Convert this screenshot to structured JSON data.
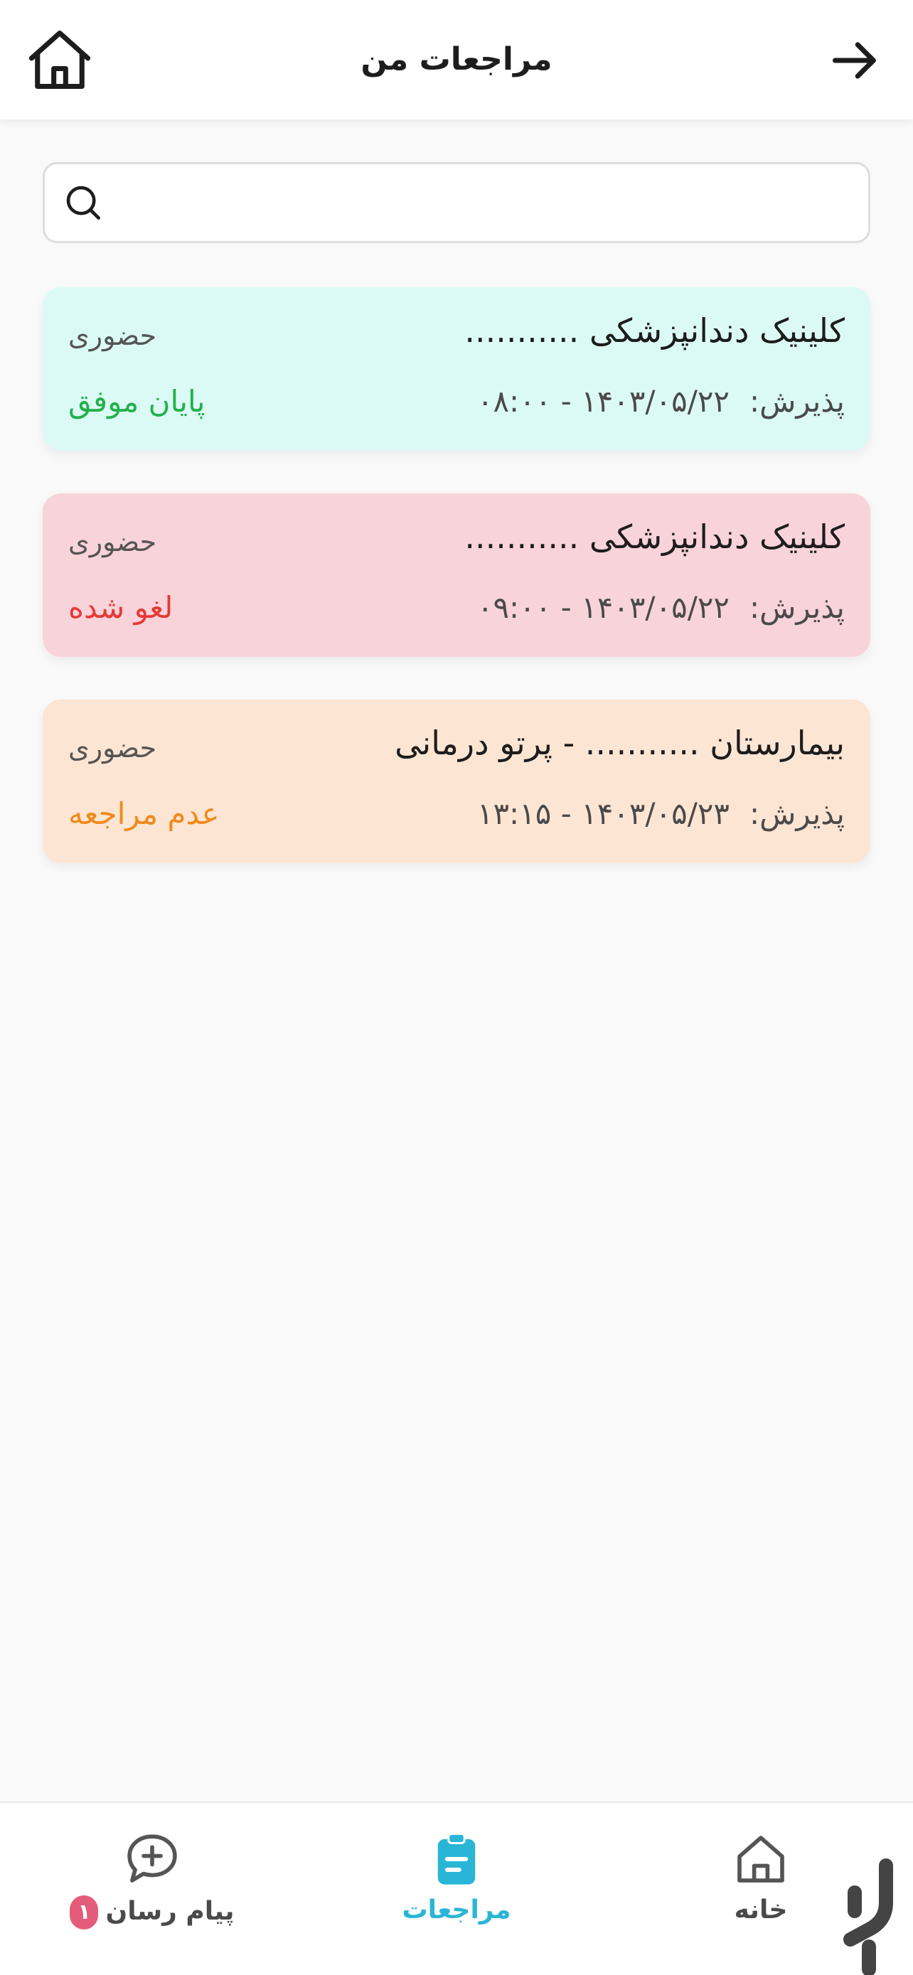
{
  "header": {
    "title": "مراجعات من"
  },
  "search": {
    "placeholder": "",
    "value": ""
  },
  "appointments": [
    {
      "name": "کلینیک دندانپزشکی ...........",
      "type": "حضوری",
      "reception_label": "پذیرش:",
      "datetime": "۱۴۰۳/۰۵/۲۲ - ۰۸:۰۰",
      "status": "پایان موفق",
      "bg_color": "#dcfaf5",
      "status_color": "#22b14c"
    },
    {
      "name": "کلینیک دندانپزشکی ...........",
      "type": "حضوری",
      "reception_label": "پذیرش:",
      "datetime": "۱۴۰۳/۰۵/۲۲ - ۰۹:۰۰",
      "status": "لغو شده",
      "bg_color": "#f9d3da",
      "status_color": "#e53935"
    },
    {
      "name": "بیمارستان ........... - پرتو درمانی",
      "type": "حضوری",
      "reception_label": "پذیرش:",
      "datetime": "۱۴۰۳/۰۵/۲۳ - ۱۳:۱۵",
      "status": "عدم مراجعه",
      "bg_color": "#fde5d3",
      "status_color": "#f08a1c"
    }
  ],
  "bottom_nav": {
    "home_label": "خانه",
    "appointments_label": "مراجعات",
    "messenger_label": "پیام رسان",
    "messenger_badge": "۱",
    "active_color": "#29b6d6"
  },
  "icons": {
    "back": "arrow-right-icon",
    "home": "home-icon",
    "search": "search-icon",
    "nav_home": "home-icon",
    "nav_appointments": "clipboard-icon",
    "nav_messenger": "chat-plus-icon",
    "store_logo": "bazaar-logo-icon"
  }
}
